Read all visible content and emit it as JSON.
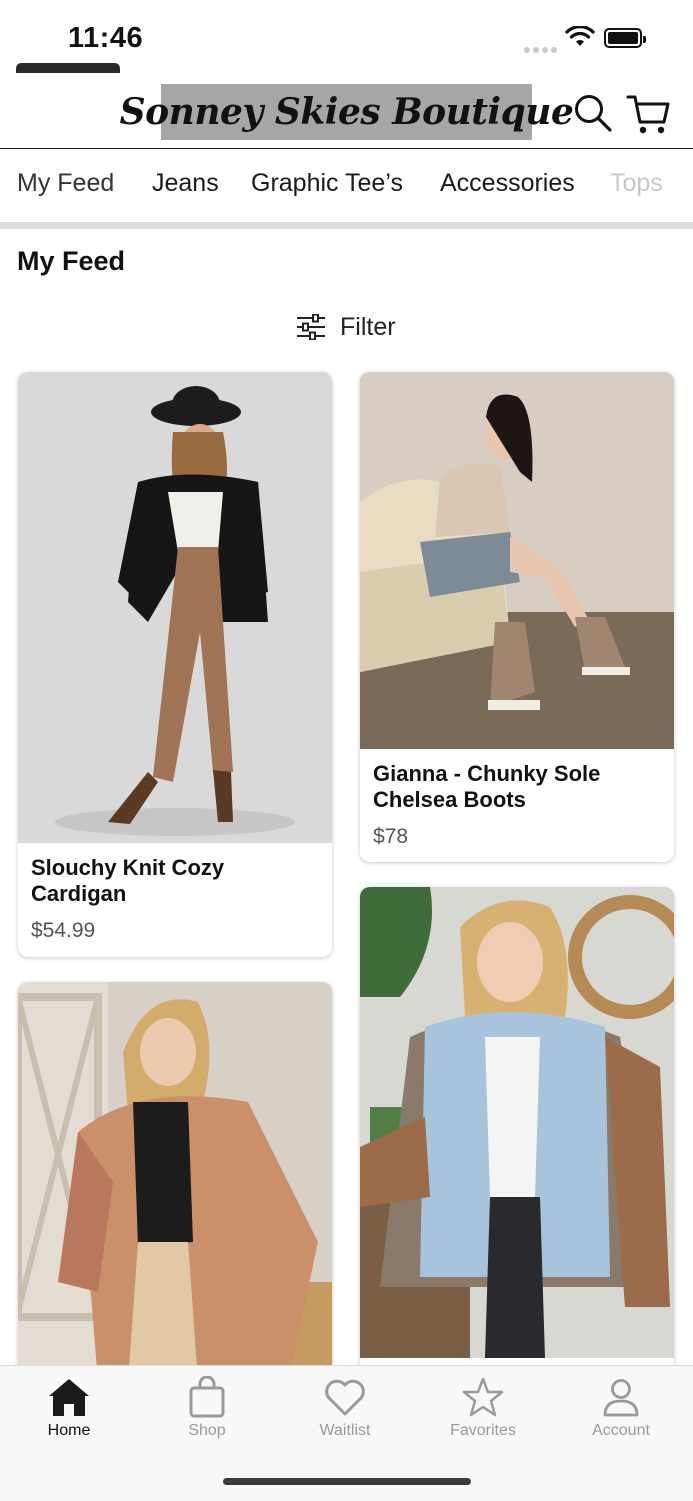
{
  "status_bar": {
    "time": "11:46"
  },
  "header": {
    "logo_text": "Sonney Skies Boutique"
  },
  "tabs": [
    {
      "label": "My Feed",
      "selected": true
    },
    {
      "label": "Jeans"
    },
    {
      "label": "Graphic Tee’s"
    },
    {
      "label": "Accessories"
    },
    {
      "label": "Tops"
    }
  ],
  "section": {
    "title": "My Feed",
    "filter_label": "Filter"
  },
  "products": [
    {
      "name": "Slouchy Knit Cozy Cardigan",
      "price": "$54.99"
    },
    {
      "name": "Gianna - Chunky Sole Chelsea Boots",
      "price": "$78"
    }
  ],
  "bottom_nav": [
    {
      "label": "Home",
      "icon": "home-icon",
      "active": true
    },
    {
      "label": "Shop",
      "icon": "shopping-bag-icon"
    },
    {
      "label": "Waitlist",
      "icon": "heart-icon"
    },
    {
      "label": "Favorites",
      "icon": "star-icon"
    },
    {
      "label": "Account",
      "icon": "person-icon"
    }
  ]
}
